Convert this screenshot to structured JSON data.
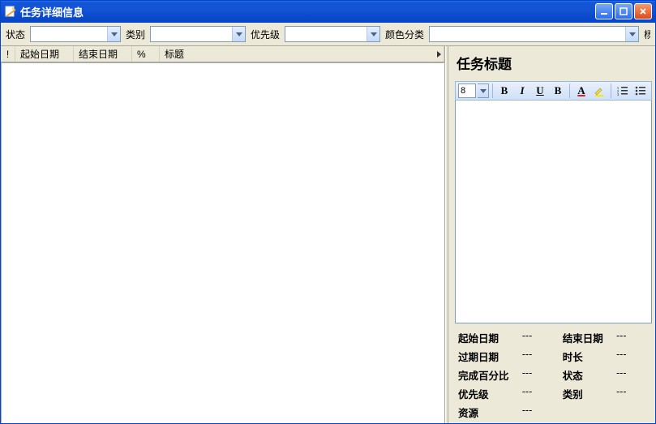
{
  "window": {
    "title": "任务详细信息"
  },
  "filters": {
    "status_label": "状态",
    "status_value": "",
    "category_label": "类别",
    "category_value": "",
    "priority_label": "优先级",
    "priority_value": "",
    "color_label": "颜色分类",
    "color_value": "",
    "trailing": "杨"
  },
  "columns": {
    "mark": "!",
    "start": "起始日期",
    "end": "结束日期",
    "pct": "%",
    "title": "标题"
  },
  "right": {
    "heading": "任务标题",
    "font_size": "8"
  },
  "details": {
    "start_label": "起始日期",
    "start_val": "---",
    "end_label": "结束日期",
    "end_val": "---",
    "due_label": "过期日期",
    "due_val": "---",
    "dur_label": "时长",
    "dur_val": "---",
    "pct_label": "完成百分比",
    "pct_val": "---",
    "status_label": "状态",
    "status_val": "---",
    "pri_label": "优先级",
    "pri_val": "---",
    "cat_label": "类别",
    "cat_val": "---",
    "res_label": "资源",
    "res_val": "---"
  }
}
